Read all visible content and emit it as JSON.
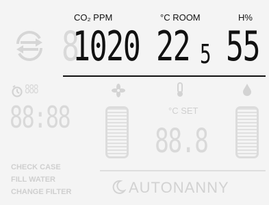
{
  "labels": {
    "co2": "CO₂ PPM",
    "room": "°C ROOM",
    "humidity": "H%",
    "set": "°C SET"
  },
  "readings": {
    "co2": "1020",
    "co2_ghost": "8",
    "room_main": "22",
    "room_decimal": "5",
    "humidity": "55"
  },
  "ghost": {
    "timer_small": "888",
    "clock": "88:88",
    "set_temp": "88.8"
  },
  "status": {
    "check_case": "CHECK CASE",
    "fill_water": "FILL WATER",
    "change_filter": "CHANGE FILTER"
  },
  "brand": "AUTONANNY",
  "icons": [
    "sync-icon",
    "timer-icon",
    "fan-icon",
    "thermometer-icon",
    "water-drop-icon",
    "moon-icon"
  ],
  "colors": {
    "active": "#111111",
    "inactive": "#d9d9d9",
    "background": "#f4f4f4"
  }
}
